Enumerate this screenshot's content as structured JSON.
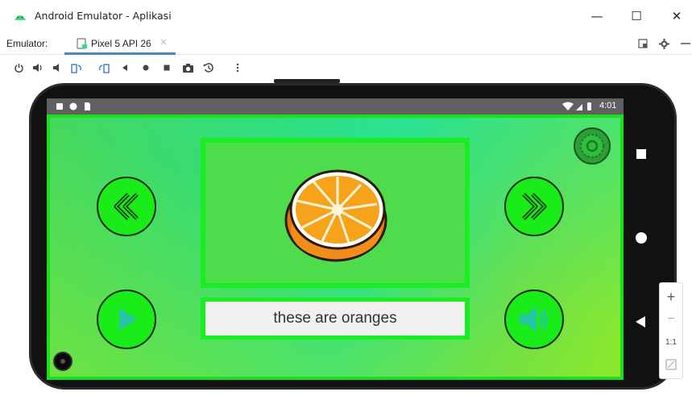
{
  "window": {
    "title": "Android Emulator - Aplikasi",
    "minimize_glyph": "—",
    "maximize_glyph": "☐",
    "close_glyph": "✕"
  },
  "tabbar": {
    "emulator_label": "Emulator:",
    "tab_label": "Pixel 5 API 26",
    "tab_close": "×"
  },
  "device": {
    "status_time": "4:01"
  },
  "app": {
    "caption": "these are oranges"
  },
  "zoom": {
    "plus": "+",
    "minus": "−",
    "one_to_one": "1:1"
  },
  "colors": {
    "accent_tab": "#4a86c8",
    "button_green": "#19ec19",
    "card_border": "#19ee22",
    "image_bg": "#4edc4c",
    "caption_bg": "#f2efef"
  },
  "icons": [
    "android-logo-icon",
    "device-tab-icon",
    "power-icon",
    "volume-up-icon",
    "volume-down-icon",
    "rotate-left-icon",
    "rotate-right-icon",
    "back-icon",
    "home-icon",
    "overview-icon",
    "camera-icon",
    "snapshot-icon",
    "more-icon",
    "settings-icon",
    "layout-icon"
  ]
}
